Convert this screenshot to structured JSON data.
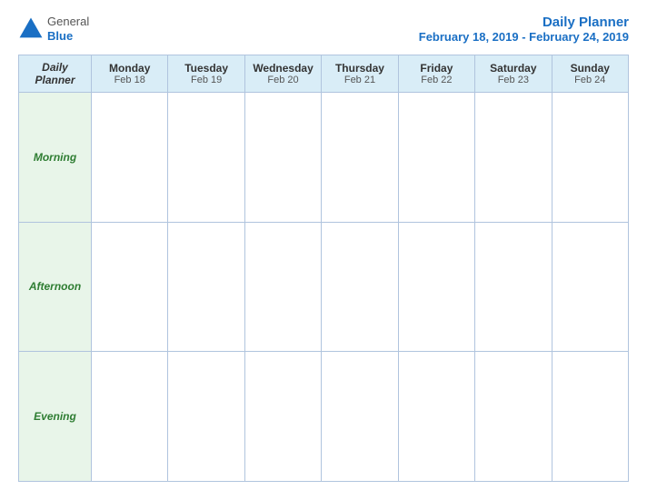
{
  "header": {
    "logo": {
      "general": "General",
      "blue": "Blue",
      "icon_shape": "triangle"
    },
    "title": "Daily Planner",
    "subtitle": "February 18, 2019 - February 24, 2019"
  },
  "table": {
    "corner_label_line1": "Daily",
    "corner_label_line2": "Planner",
    "columns": [
      {
        "day": "Monday",
        "date": "Feb 18"
      },
      {
        "day": "Tuesday",
        "date": "Feb 19"
      },
      {
        "day": "Wednesday",
        "date": "Feb 20"
      },
      {
        "day": "Thursday",
        "date": "Feb 21"
      },
      {
        "day": "Friday",
        "date": "Feb 22"
      },
      {
        "day": "Saturday",
        "date": "Feb 23"
      },
      {
        "day": "Sunday",
        "date": "Feb 24"
      }
    ],
    "rows": [
      {
        "label": "Morning"
      },
      {
        "label": "Afternoon"
      },
      {
        "label": "Evening"
      }
    ]
  }
}
